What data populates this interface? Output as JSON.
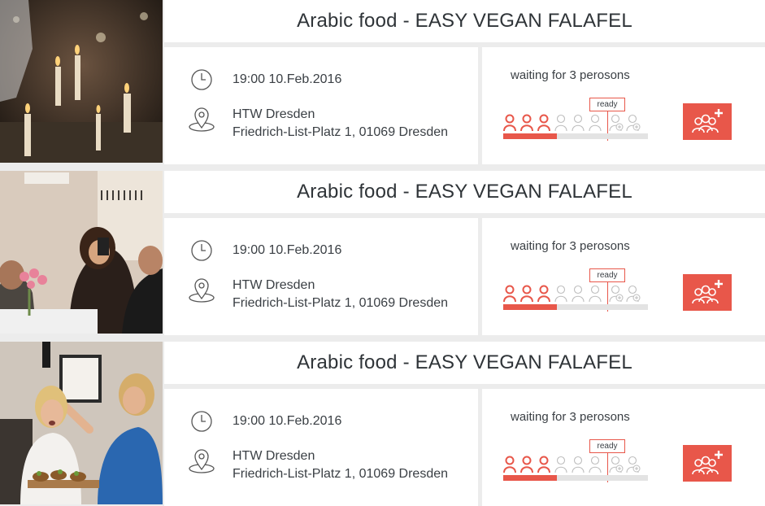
{
  "colors": {
    "accent": "#e8574a",
    "inactive": "#bdbdbd",
    "background": "#ececec"
  },
  "events": [
    {
      "title": "Arabic food - EASY VEGAN FALAFEL",
      "time": "19:00  10.Feb.2016",
      "venue": "HTW Dresden",
      "address": "Friedrich-List-Platz 1, 01069 Dresden",
      "waiting": "waiting for 3 perosons",
      "ready_label": "ready",
      "participants_joined": 3,
      "seats_min": 6,
      "seats_total": 8,
      "photo_icon": "candles-dinner-photo"
    },
    {
      "title": "Arabic food - EASY VEGAN FALAFEL",
      "time": "19:00  10.Feb.2016",
      "venue": "HTW Dresden",
      "address": "Friedrich-List-Platz 1, 01069 Dresden",
      "waiting": "waiting for 3 perosons",
      "ready_label": "ready",
      "participants_joined": 3,
      "seats_min": 6,
      "seats_total": 8,
      "photo_icon": "friends-dinner-photo"
    },
    {
      "title": "Arabic food - EASY VEGAN FALAFEL",
      "time": "19:00  10.Feb.2016",
      "venue": "HTW Dresden",
      "address": "Friedrich-List-Platz 1, 01069 Dresden",
      "waiting": "waiting for 3 perosons",
      "ready_label": "ready",
      "participants_joined": 3,
      "seats_min": 6,
      "seats_total": 8,
      "photo_icon": "serving-food-photo"
    }
  ],
  "icons": {
    "time": "clock-icon",
    "location": "location-pin-icon",
    "join": "add-group-icon"
  }
}
